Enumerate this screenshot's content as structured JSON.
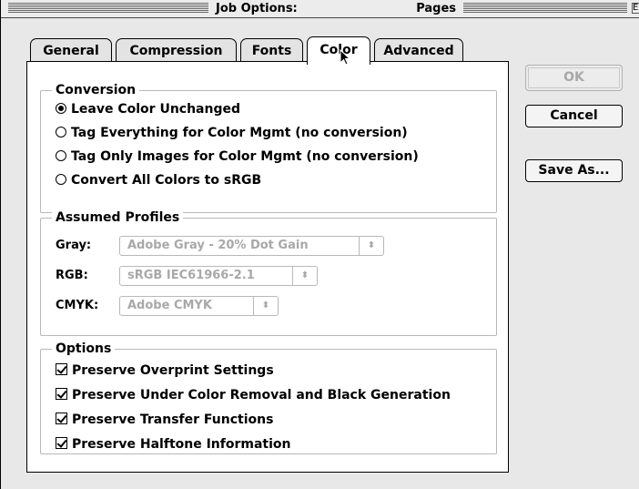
{
  "window": {
    "title": "Job Options:",
    "subtitle": "Pages",
    "zoom_glyph": "E"
  },
  "tabs": [
    {
      "label": "General",
      "active": false
    },
    {
      "label": "Compression",
      "active": false
    },
    {
      "label": "Fonts",
      "active": false
    },
    {
      "label": "Color",
      "active": true
    },
    {
      "label": "Advanced",
      "active": false
    }
  ],
  "conversion": {
    "title": "Conversion",
    "options": [
      {
        "label": "Leave Color Unchanged",
        "selected": true
      },
      {
        "label": "Tag Everything for Color Mgmt (no conversion)",
        "selected": false
      },
      {
        "label": "Tag Only Images for Color Mgmt (no conversion)",
        "selected": false
      },
      {
        "label": "Convert All Colors to sRGB",
        "selected": false
      }
    ]
  },
  "profiles": {
    "title": "Assumed Profiles",
    "gray": {
      "label": "Gray:",
      "value": "Adobe Gray - 20% Dot Gain",
      "enabled": false
    },
    "rgb": {
      "label": "RGB:",
      "value": "sRGB IEC61966-2.1",
      "enabled": false
    },
    "cmyk": {
      "label": "CMYK:",
      "value": "Adobe CMYK",
      "enabled": false
    },
    "arrows_glyph": "⬍"
  },
  "options": {
    "title": "Options",
    "items": [
      {
        "label": "Preserve Overprint Settings",
        "checked": true
      },
      {
        "label": "Preserve Under Color Removal and Black Generation",
        "checked": true
      },
      {
        "label": "Preserve Transfer Functions",
        "checked": true
      },
      {
        "label": "Preserve Halftone Information",
        "checked": true
      }
    ]
  },
  "buttons": {
    "ok": {
      "label": "OK",
      "enabled": false
    },
    "cancel": {
      "label": "Cancel",
      "enabled": true
    },
    "save_as": {
      "label": "Save As...",
      "enabled": true
    }
  },
  "colors": {
    "window_bg": "#e8e8e8",
    "panel_bg": "#ffffff",
    "disabled_text": "#a8a8a8"
  }
}
